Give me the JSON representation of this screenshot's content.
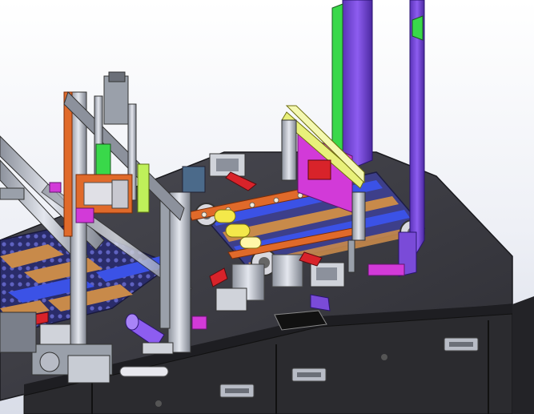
{
  "scene": {
    "kind": "cad-assembly-render",
    "icons": [
      "machine-frame",
      "conveyor",
      "gantry-column",
      "servo-motor",
      "pneumatic-cylinder",
      "handle",
      "cable-chain"
    ],
    "colors": {
      "background_top": "#ffffff",
      "background_bottom": "#d9dde8",
      "cabinet": "#2b2b2f",
      "cabinet_top": "#3a3a3f",
      "conveyor_belt": "#3d3f8a",
      "belt_stripe_blue": "#3b52e6",
      "belt_stripe_tan": "#c88a4a",
      "purple_column": "#7a4bd8",
      "green_plate": "#39d84a",
      "magenta_plate": "#d23ad8",
      "yellow_bar": "#e8f07a",
      "orange_part": "#e06a2a",
      "red_part": "#d8232a",
      "aluminum": "#b9bec8"
    }
  }
}
